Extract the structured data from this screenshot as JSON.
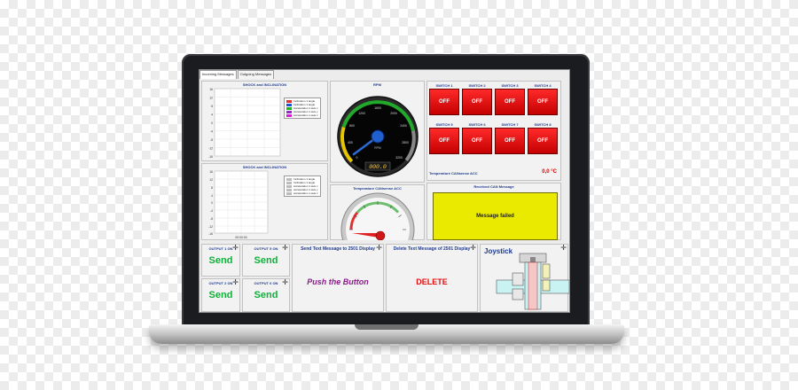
{
  "tabs": [
    "Incoming Messages",
    "Outgoing Messages"
  ],
  "charts": {
    "shock_top": {
      "title": "SHOCK and INCLINATION",
      "y_ticks": [
        "16",
        "12",
        "8",
        "4",
        "0",
        "-4",
        "-8",
        "-12",
        "-16"
      ],
      "legend": [
        "Inclination 1 angle",
        "Inclination 1 angle",
        "Acceleration 1 axis x",
        "Acceleration 1 axis y",
        "Acceleration 1 axis z"
      ],
      "legend_colors": [
        "#e03030",
        "#2050e0",
        "#20b020",
        "#9030c0",
        "#d020d0"
      ]
    },
    "shock_bottom": {
      "title": "SHOCK and INCLINATION",
      "y_ticks": [
        "16",
        "12",
        "8",
        "4",
        "0",
        "-4",
        "-8",
        "-12",
        "-16"
      ],
      "x_label": "00:00:00",
      "legend": [
        "Inclination 1 angle",
        "Inclination 1 angle",
        "Acceleration 1 axis x",
        "Acceleration 1 axis y",
        "Acceleration 1 axis z"
      ],
      "legend_colors": [
        "#bbbbbb",
        "#bbbbbb",
        "#bbbbbb",
        "#bbbbbb",
        "#bbbbbb"
      ]
    }
  },
  "rpm": {
    "title": "RPM",
    "ticks": [
      "0",
      "400",
      "800",
      "1200",
      "1600",
      "2000",
      "2400",
      "2800",
      "3200"
    ],
    "unit": "RPM",
    "display": "000.0"
  },
  "switches": {
    "row1": [
      {
        "label": "SWITCH 1",
        "state": "OFF"
      },
      {
        "label": "SWITCH 2",
        "state": "OFF"
      },
      {
        "label": "SWITCH 3",
        "state": "OFF"
      },
      {
        "label": "SWITCH 4",
        "state": "OFF"
      }
    ],
    "row2": [
      {
        "label": "SWITCH 5",
        "state": "OFF"
      },
      {
        "label": "SWITCH 6",
        "state": "OFF"
      },
      {
        "label": "SWITCH 7",
        "state": "OFF"
      },
      {
        "label": "SWITCH 8",
        "state": "OFF"
      }
    ]
  },
  "temp_readout": {
    "label": "Temperature CANsense ACC",
    "value": "0,0 °C"
  },
  "temp_gauge": {
    "title": "Temperature CANsense ACC"
  },
  "received": {
    "title": "Received CAN Message",
    "message": "Message failed"
  },
  "outputs": [
    {
      "label": "OUTPUT 1 ON",
      "button": "Send"
    },
    {
      "label": "OUTPUT 5 ON",
      "button": "Send"
    },
    {
      "label": "OUTPUT 2 ON",
      "button": "Send"
    },
    {
      "label": "OUTPUT 6 ON",
      "button": "Send"
    }
  ],
  "send_text": {
    "title": "Send Text Message to 2501 Display",
    "button": "Push the Button"
  },
  "delete_text": {
    "title": "Delete Text Message of 2501 Display",
    "button": "DELETE"
  },
  "joystick": {
    "title": "Joystick"
  },
  "colors": {
    "accent_blue": "#1f3b8f",
    "switch_red": "#d40000",
    "send_green": "#0fb13a",
    "message_yellow": "#eaea00"
  }
}
